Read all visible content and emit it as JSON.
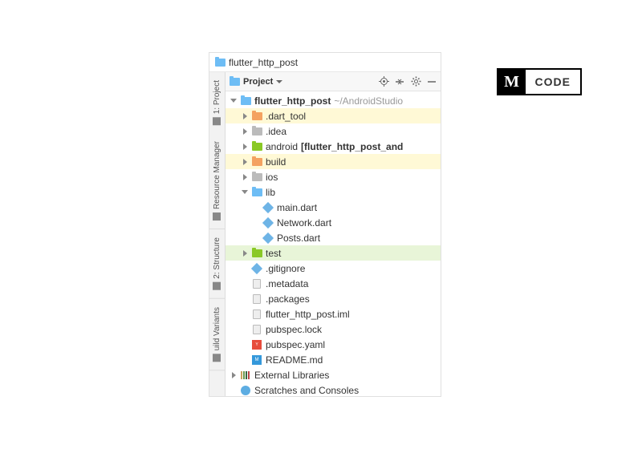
{
  "breadcrumb": {
    "name": "flutter_http_post"
  },
  "panel": {
    "title": "Project"
  },
  "sidebar_tabs": [
    {
      "label": "1: Project"
    },
    {
      "label": "Resource Manager"
    },
    {
      "label": "2: Structure"
    },
    {
      "label": "uild Variants"
    }
  ],
  "logo": {
    "m": "M",
    "code": "CODE"
  },
  "tree": {
    "root": {
      "name": "flutter_http_post",
      "path": "~/AndroidStudio"
    },
    "items": [
      {
        "name": ".dart_tool",
        "color": "orange",
        "hl": "yellow"
      },
      {
        "name": ".idea",
        "color": "gray"
      },
      {
        "name": "android",
        "suffix": "[flutter_http_post_and",
        "color": "green",
        "bold_suffix": true
      },
      {
        "name": "build",
        "color": "orange",
        "hl": "yellow"
      },
      {
        "name": "ios",
        "color": "gray"
      }
    ],
    "lib": {
      "name": "lib",
      "files": [
        {
          "name": "main.dart"
        },
        {
          "name": "Network.dart"
        },
        {
          "name": "Posts.dart"
        }
      ]
    },
    "test": {
      "name": "test"
    },
    "files": [
      {
        "name": ".gitignore",
        "icon": "dart"
      },
      {
        "name": ".metadata",
        "icon": "file"
      },
      {
        "name": ".packages",
        "icon": "file"
      },
      {
        "name": "flutter_http_post.iml",
        "icon": "file"
      },
      {
        "name": "pubspec.lock",
        "icon": "file"
      },
      {
        "name": "pubspec.yaml",
        "icon": "yaml"
      },
      {
        "name": "README.md",
        "icon": "md"
      }
    ],
    "external": {
      "name": "External Libraries"
    },
    "scratches": {
      "name": "Scratches and Consoles"
    }
  }
}
